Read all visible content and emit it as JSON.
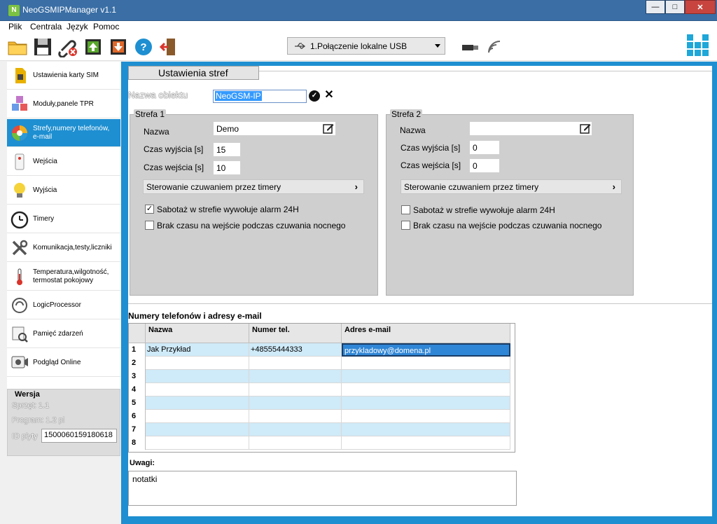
{
  "window": {
    "title": "NeoGSMIPManager v1.1",
    "controls": {
      "minimize": "—",
      "maximize": "□",
      "close": "✕"
    }
  },
  "menu": [
    "Plik",
    "Centrala",
    "Język",
    "Pomoc"
  ],
  "toolbar": {
    "icons": [
      "folder-icon",
      "save-icon",
      "disconnect-icon",
      "upload-icon",
      "download-icon",
      "help-icon",
      "exit-icon"
    ],
    "connection": "1.Połączenie lokalne USB"
  },
  "sidebar": {
    "items": [
      {
        "label": "Ustawienia karty SIM",
        "icon": "sim-card-icon"
      },
      {
        "label": "Moduły,panele TPR",
        "icon": "modules-icon"
      },
      {
        "label": "Strefy,numery telefonów, e-mail",
        "icon": "zones-icon"
      },
      {
        "label": "Wejścia",
        "icon": "inputs-icon"
      },
      {
        "label": "Wyjścia",
        "icon": "outputs-bulb-icon"
      },
      {
        "label": "Timery",
        "icon": "clock-icon"
      },
      {
        "label": "Komunikacja,testy,liczniki",
        "icon": "tools-icon"
      },
      {
        "label": "Temperatura,wilgotność, termostat pokojowy",
        "icon": "thermometer-icon"
      },
      {
        "label": "LogicProcessor",
        "icon": "logic-icon"
      },
      {
        "label": "Pamięć zdarzeń",
        "icon": "event-log-icon"
      },
      {
        "label": "Podgląd Online",
        "icon": "online-view-icon"
      }
    ],
    "active_index": 2,
    "version": {
      "legend": "Wersja",
      "hardware": "Sprzęt: 1.1",
      "program": "Program: 1.2 pl",
      "id_label": "ID płyty",
      "id_value": "1500060159180618"
    }
  },
  "main": {
    "section_title": "Ustawienia stref",
    "object_name_label": "Nazwa obiektu",
    "object_name_value": "NeoGSM-IP",
    "zones": [
      {
        "legend": "Strefa 1",
        "name_label": "Nazwa",
        "name_value": "Demo",
        "exit_label": "Czas wyjścia [s]",
        "exit_value": "15",
        "entry_label": "Czas wejścia [s]",
        "entry_value": "10",
        "timer_button": "Sterowanie czuwaniem przez timery",
        "sabotage_label": "Sabotaż w strefie wywołuje alarm 24H",
        "sabotage_checked": true,
        "night_label": "Brak czasu na wejście podczas czuwania nocnego",
        "night_checked": false
      },
      {
        "legend": "Strefa 2",
        "name_label": "Nazwa",
        "name_value": "",
        "exit_label": "Czas wyjścia [s]",
        "exit_value": "0",
        "entry_label": "Czas wejścia [s]",
        "entry_value": "0",
        "timer_button": "Sterowanie czuwaniem przez timery",
        "sabotage_label": "Sabotaż w strefie wywołuje alarm 24H",
        "sabotage_checked": false,
        "night_label": "Brak czasu na wejście podczas czuwania nocnego",
        "night_checked": false
      }
    ],
    "phones_title": "Numery telefonów i adresy e-mail",
    "table": {
      "columns": [
        "Nazwa",
        "Numer tel.",
        "Adres e-mail"
      ],
      "rows": [
        {
          "num": "1",
          "name": "Jak Przykład",
          "phone": "+48555444333",
          "email": "przykladowy@domena.pl"
        },
        {
          "num": "2",
          "name": "",
          "phone": "",
          "email": ""
        },
        {
          "num": "3",
          "name": "",
          "phone": "",
          "email": ""
        },
        {
          "num": "4",
          "name": "",
          "phone": "",
          "email": ""
        },
        {
          "num": "5",
          "name": "",
          "phone": "",
          "email": ""
        },
        {
          "num": "6",
          "name": "",
          "phone": "",
          "email": ""
        },
        {
          "num": "7",
          "name": "",
          "phone": "",
          "email": ""
        },
        {
          "num": "8",
          "name": "",
          "phone": "",
          "email": ""
        }
      ]
    },
    "notes_label": "Uwagi:",
    "notes_value": "notatki"
  },
  "colors": {
    "accent": "#1e8fd1",
    "titlebar": "#3a6ea5",
    "zone_bg": "#cfcfcf",
    "row_alt": "#cfeaf8"
  }
}
